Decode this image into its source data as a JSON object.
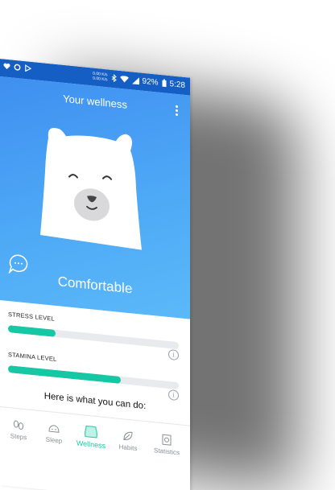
{
  "status_bar": {
    "net_rate_up": "0.00 K/s",
    "net_rate_down": "0.00 K/s",
    "battery": "92%",
    "time": "5:28",
    "icons": [
      "heart-icon",
      "circle-icon",
      "play-icon",
      "bluetooth-icon",
      "wifi-icon",
      "signal-icon",
      "battery-icon"
    ]
  },
  "header": {
    "title": "Your wellness",
    "menu_icon": "more-vert-icon"
  },
  "hero": {
    "mood": "Comfortable",
    "chat_icon": "chat-bubble-icon",
    "colors": {
      "top": "#3f8ff0",
      "bottom": "#5bb9f8"
    }
  },
  "levels": [
    {
      "label": "STRESS LEVEL",
      "value": 0.28,
      "info_icon": "info-icon"
    },
    {
      "label": "STAMINA LEVEL",
      "value": 0.66,
      "info_icon": "info-icon"
    }
  ],
  "prompt": "Here is what you can do:",
  "nav": {
    "items": [
      {
        "label": "Steps",
        "icon": "footprints-icon",
        "active": false
      },
      {
        "label": "Sleep",
        "icon": "sleep-icon",
        "active": false
      },
      {
        "label": "Wellness",
        "icon": "bear-face-icon",
        "active": true
      },
      {
        "label": "Habits",
        "icon": "leaf-icon",
        "active": false
      },
      {
        "label": "Statistics",
        "icon": "statistics-icon",
        "active": false
      }
    ],
    "accent": "#16c7a4"
  }
}
